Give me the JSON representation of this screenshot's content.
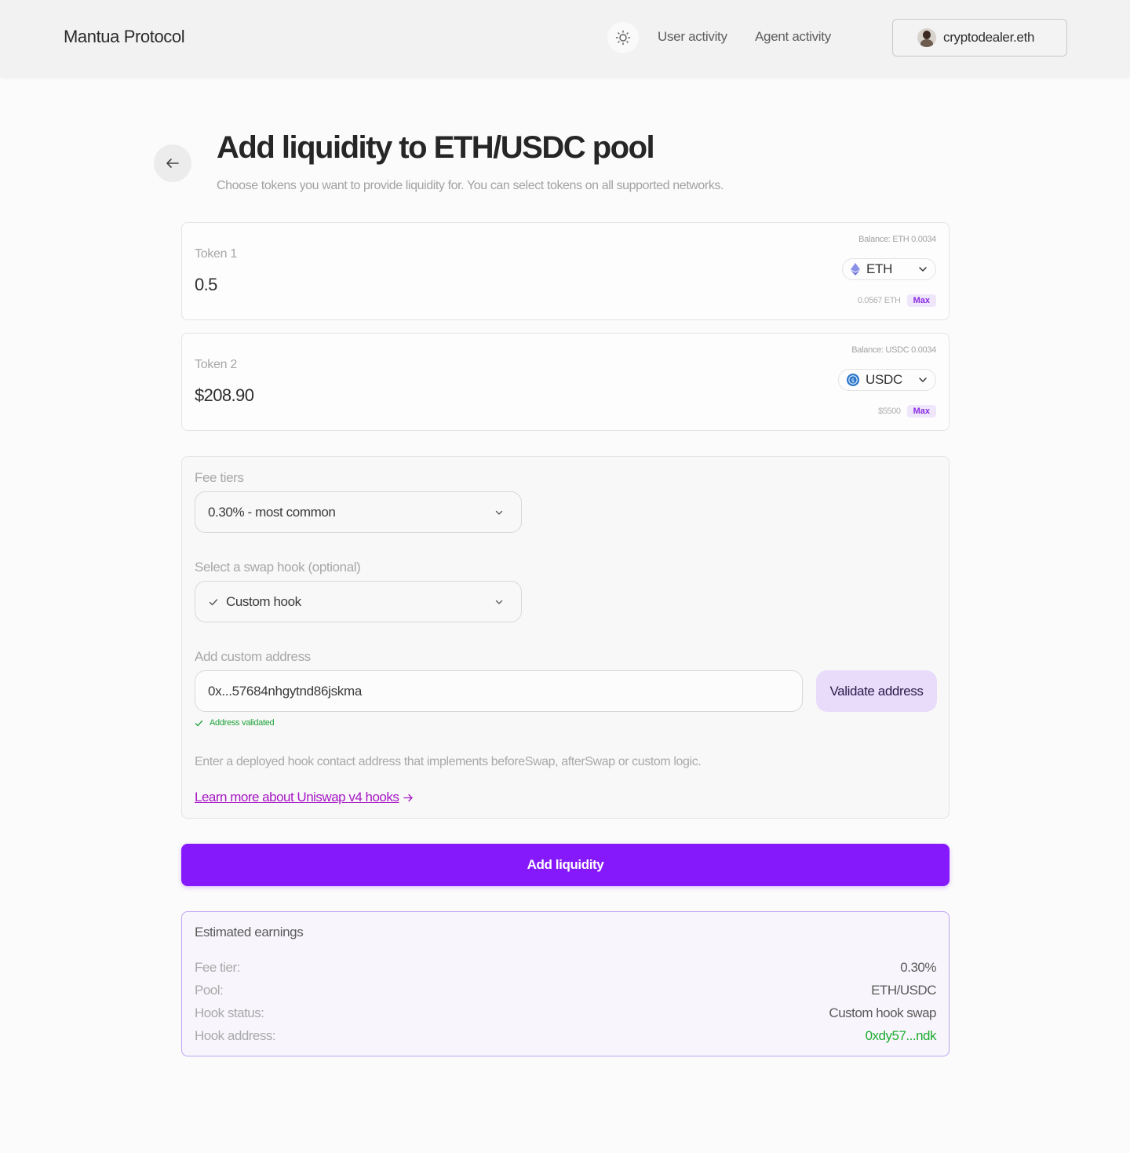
{
  "header": {
    "brand": "Mantua Protocol",
    "nav": [
      "User activity",
      "Agent activity"
    ],
    "wallet": "cryptodealer.eth"
  },
  "page": {
    "title": "Add liquidity to ETH/USDC pool",
    "subtitle": "Choose tokens you want to provide liquidity for. You can select tokens on all supported networks."
  },
  "tokens": [
    {
      "label": "Token 1",
      "amount": "0.5",
      "balance": "Balance:  ETH  0.0034",
      "symbol": "ETH",
      "sub_value": "0.0567 ETH",
      "max": "Max",
      "icon": "ethereum-icon"
    },
    {
      "label": "Token 2",
      "amount": "$208.90",
      "balance": "Balance:  USDC  0.0034",
      "symbol": "USDC",
      "sub_value": "$5500",
      "max": "Max",
      "icon": "usdc-icon"
    }
  ],
  "settings": {
    "fee_label": "Fee tiers",
    "fee_value": "0.30% - most common",
    "hook_label": "Select a swap hook (optional)",
    "hook_value": "Custom hook",
    "address_label": "Add custom address",
    "address_value": "0x...57684nhgytnd86jskma",
    "validate_button": "Validate address",
    "validated_text": "Address validated",
    "hint": "Enter a deployed hook contact address that implements beforeSwap, afterSwap or custom logic.",
    "learn_more": "Learn more about Uniswap v4 hooks"
  },
  "cta": "Add liquidity",
  "earnings": {
    "title": "Estimated earnings",
    "rows": [
      {
        "key": "Fee tier:",
        "value": "0.30%"
      },
      {
        "key": "Pool:",
        "value": "ETH/USDC"
      },
      {
        "key": "Hook status:",
        "value": "Custom hook swap"
      },
      {
        "key": "Hook address:",
        "value": "0xdy57...ndk"
      }
    ]
  },
  "colors": {
    "accent": "#8519fb",
    "success": "#1eab2f",
    "link": "#a617c4"
  }
}
